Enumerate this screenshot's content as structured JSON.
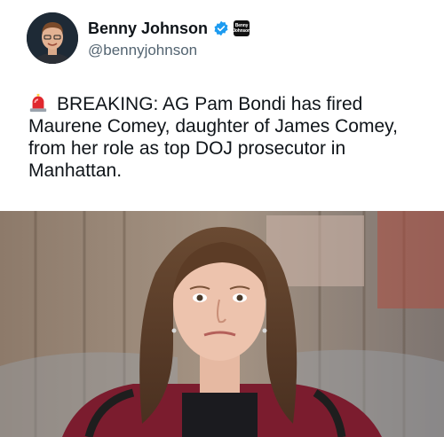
{
  "author": {
    "display_name": "Benny Johnson",
    "handle": "@bennyjohnson",
    "verified_badge_icon": "verified-check-icon",
    "affiliate_badge_text": "Benny Johnson"
  },
  "tweet": {
    "emoji_icon": "police-siren-icon",
    "text": "BREAKING: AG Pam Bondi has fired Maurene Comey, daughter of James Comey, from her role as top DOJ prosecutor in Manhattan."
  },
  "colors": {
    "verified": "#1d9bf0",
    "handle": "#536471",
    "text": "#0f1419"
  }
}
